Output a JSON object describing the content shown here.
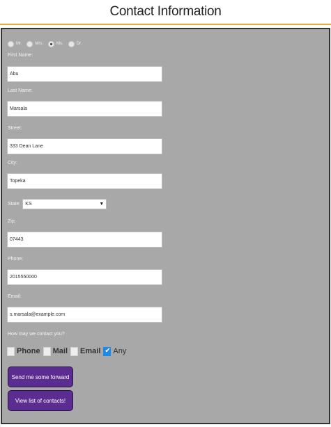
{
  "header": {
    "title": "Contact Information"
  },
  "salutation": {
    "options": [
      "Mr.",
      "Mrs.",
      "Ms.",
      "Dr."
    ],
    "selected": "Ms."
  },
  "fields": {
    "first_name": {
      "label": "First Name:",
      "value": "Abu"
    },
    "last_name": {
      "label": "Last Name:",
      "value": "Marsala"
    },
    "street": {
      "label": "Street:",
      "value": "333 Dean Lane"
    },
    "city": {
      "label": "City:",
      "value": "Topeka"
    },
    "state": {
      "label": "State:",
      "value": "KS"
    },
    "zip": {
      "label": "Zip:",
      "value": "07443"
    },
    "phone": {
      "label": "Phone:",
      "value": "2015550000"
    },
    "email": {
      "label": "Email:",
      "value": "s.marsala@example.com"
    }
  },
  "contact_method": {
    "question": "How may we contact you?",
    "options": [
      {
        "label": "Phone",
        "checked": false
      },
      {
        "label": "Mail",
        "checked": false
      },
      {
        "label": "Email",
        "checked": false
      },
      {
        "label": "Any",
        "checked": true
      }
    ]
  },
  "buttons": {
    "send": "Send me some forward",
    "view": "View list of contacts!"
  }
}
